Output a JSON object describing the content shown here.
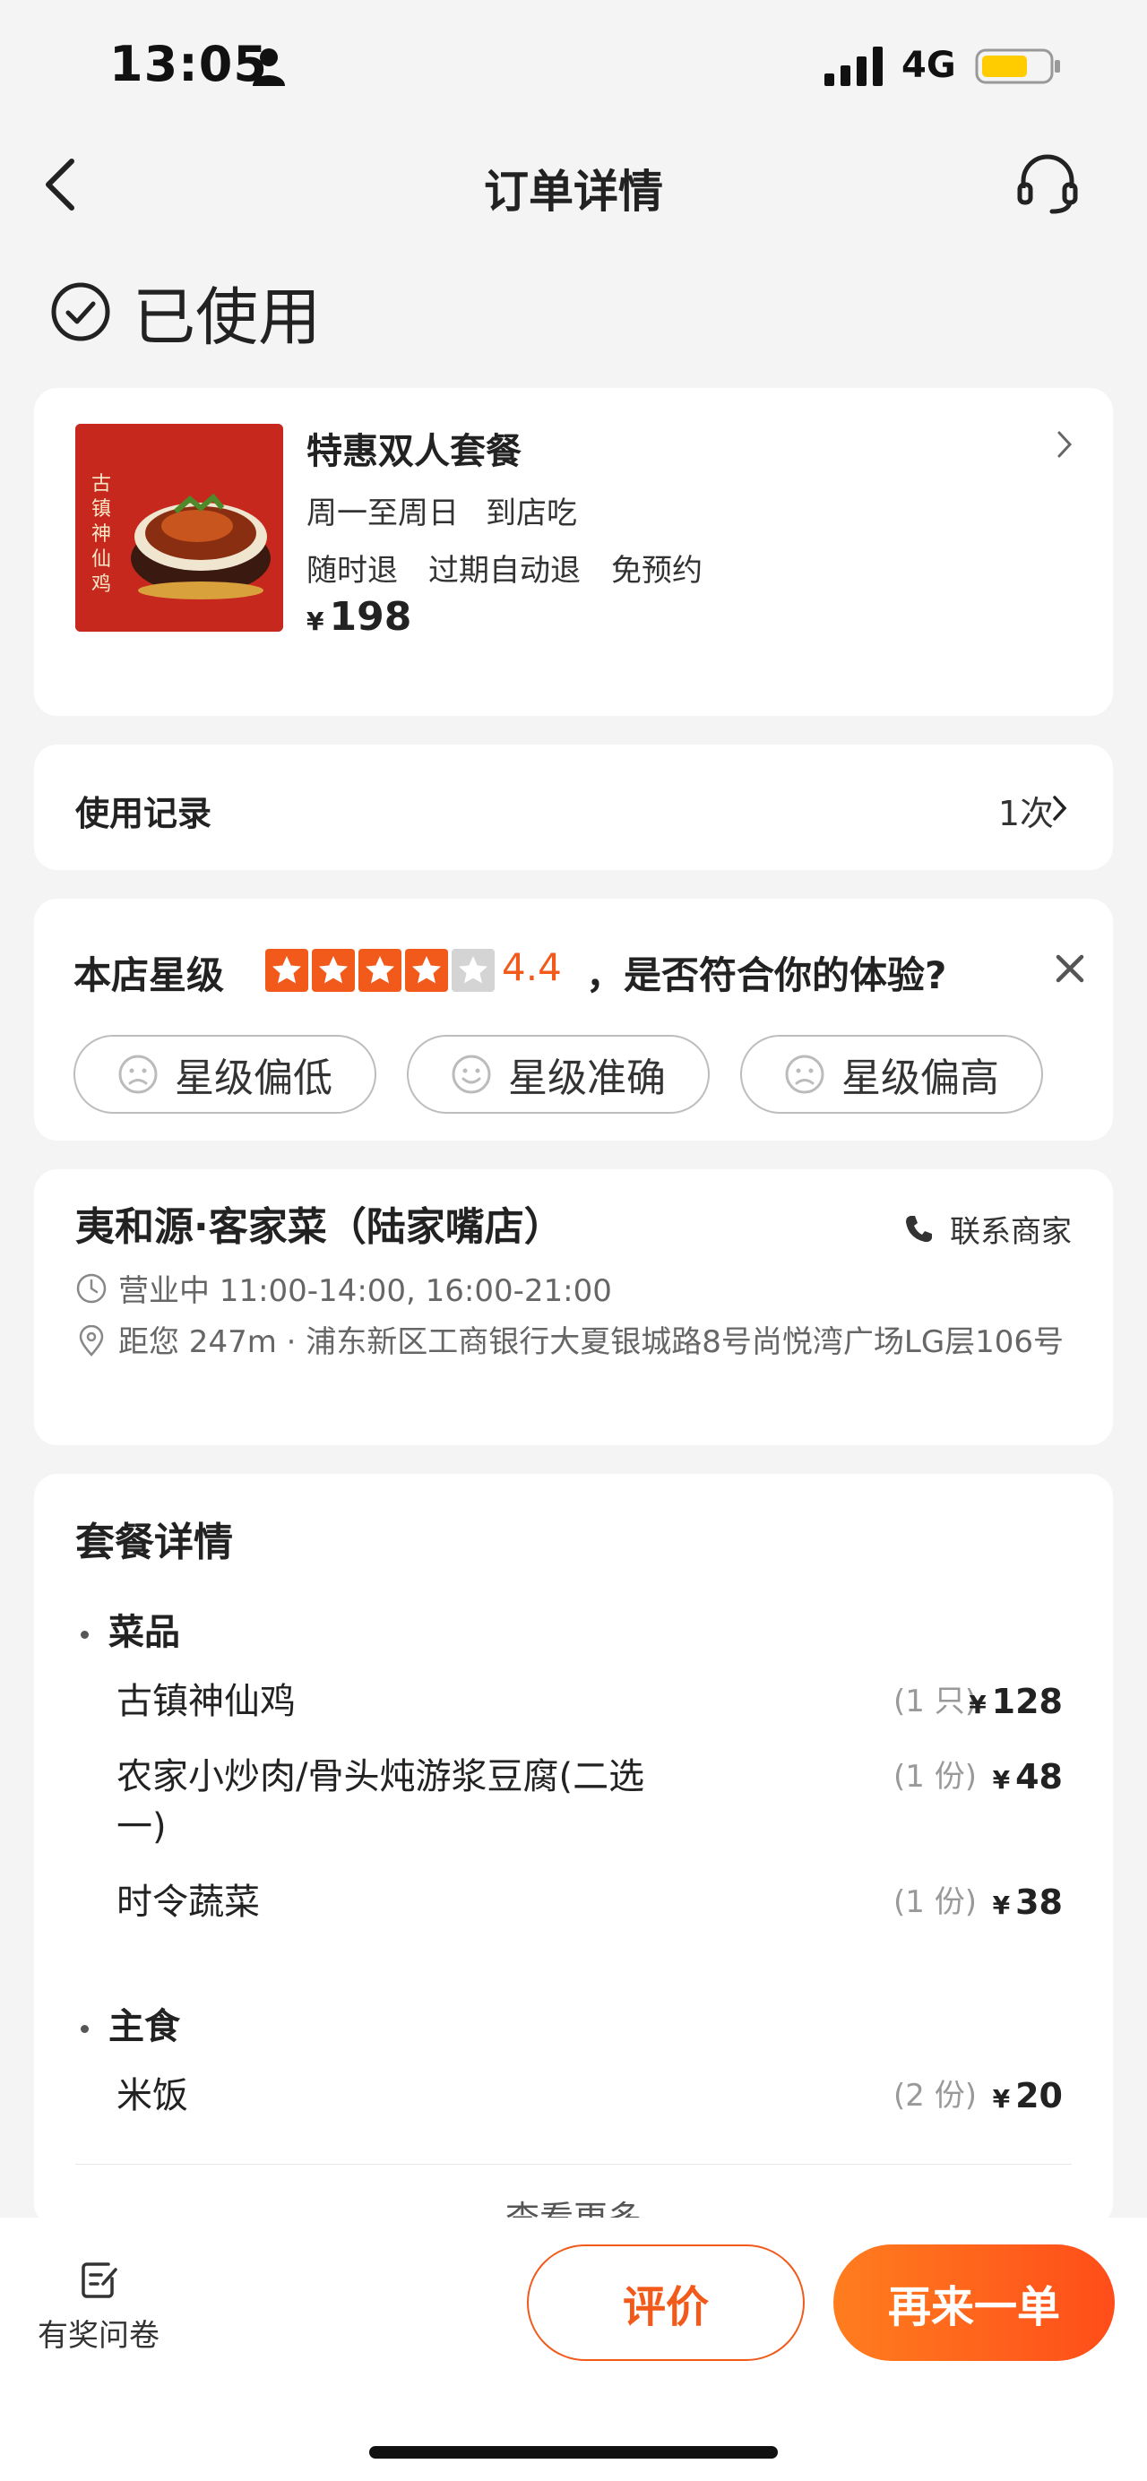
{
  "status_bar": {
    "time": "13:05",
    "network": "4G"
  },
  "nav": {
    "title": "订单详情"
  },
  "order_status": {
    "label": "已使用"
  },
  "product": {
    "image_text": "古镇神仙鸡",
    "title": "特惠双人套餐",
    "meta": [
      "周一至周日",
      "到店吃"
    ],
    "tags": [
      "随时退",
      "过期自动退",
      "免预约"
    ],
    "price_currency": "¥",
    "price": "198"
  },
  "usage": {
    "label": "使用记录",
    "count": "1次"
  },
  "rating": {
    "label": "本店星级",
    "stars": 4,
    "score": "4.4",
    "question": "，是否符合你的体验?",
    "options": [
      "星级偏低",
      "星级准确",
      "星级偏高"
    ],
    "accent_color": "#f25a1b"
  },
  "store": {
    "name": "夷和源·客家菜（陆家嘴店）",
    "phone_label": "联系商家",
    "hours": "营业中 11:00-14:00, 16:00-21:00",
    "address": "距您 247m · 浦东新区工商银行大夏银城路8号尚悦湾广场LG层106号"
  },
  "package": {
    "title": "套餐详情",
    "sections": [
      {
        "name": "菜品",
        "items": [
          {
            "name": "古镇神仙鸡",
            "qty": "(1 只)",
            "currency": "¥",
            "price": "128"
          },
          {
            "name": "农家小炒肉/骨头炖游浆豆腐(二选一)",
            "qty": "(1 份)",
            "currency": "¥",
            "price": "48"
          },
          {
            "name": "时令蔬菜",
            "qty": "(1 份)",
            "currency": "¥",
            "price": "38"
          }
        ]
      },
      {
        "name": "主食",
        "items": [
          {
            "name": "米饭",
            "qty": "(2 份)",
            "currency": "¥",
            "price": "20"
          }
        ]
      }
    ],
    "see_more": "查看更多"
  },
  "bottom": {
    "survey_label": "有奖问卷",
    "review_label": "评价",
    "reorder_label": "再来一单",
    "brand_color": "#ff5a1f"
  }
}
